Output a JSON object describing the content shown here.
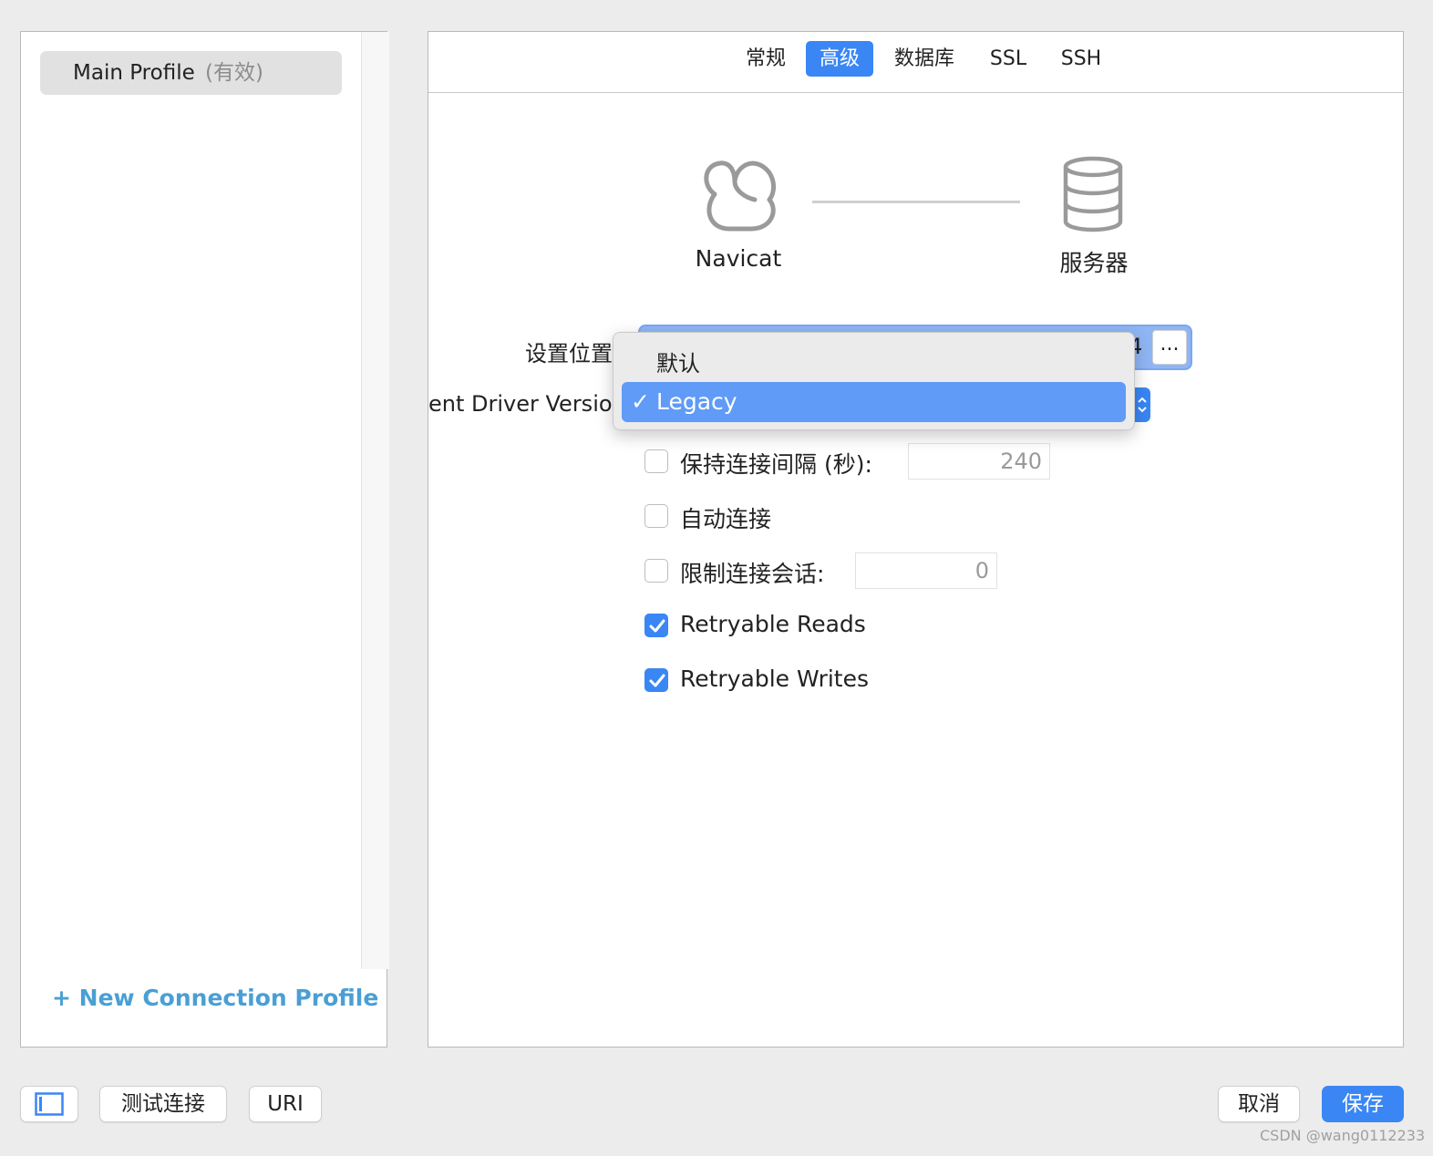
{
  "sidebar": {
    "profiles": [
      {
        "name": "Main Profile",
        "status": "(有效)"
      }
    ],
    "new_profile_label": "+ New Connection Profile"
  },
  "tabs": [
    {
      "label": "常规",
      "active": false
    },
    {
      "label": "高级",
      "active": true
    },
    {
      "label": "数据库",
      "active": false
    },
    {
      "label": "SSL",
      "active": false
    },
    {
      "label": "SSH",
      "active": false
    }
  ],
  "diagram": {
    "client_label": "Navicat",
    "server_label": "服务器",
    "client_icon": "navicat-icon",
    "server_icon": "database-icon"
  },
  "form": {
    "settings_location_label": "设置位置",
    "settings_location_value": "4",
    "browse_label": "...",
    "driver_version_label": "ent Driver Versior",
    "keepalive": {
      "label": "保持连接间隔 (秒):",
      "checked": false,
      "value": "240"
    },
    "auto_connect": {
      "label": "自动连接",
      "checked": false
    },
    "limit_sessions": {
      "label": "限制连接会话:",
      "checked": false,
      "value": "0"
    },
    "retryable_reads": {
      "label": "Retryable Reads",
      "checked": true
    },
    "retryable_writes": {
      "label": "Retryable Writes",
      "checked": true
    }
  },
  "dropdown": {
    "options": [
      "默认",
      "Legacy"
    ],
    "selected": "Legacy",
    "check_glyph": "✓"
  },
  "bottom": {
    "test_connection_label": "测试连接",
    "uri_label": "URI",
    "cancel_label": "取消",
    "save_label": "保存"
  },
  "watermark": "CSDN @wang0112233",
  "colors": {
    "accent": "#3a86f5",
    "link": "#4a9fd4",
    "menu_highlight": "#5f9bf7"
  }
}
